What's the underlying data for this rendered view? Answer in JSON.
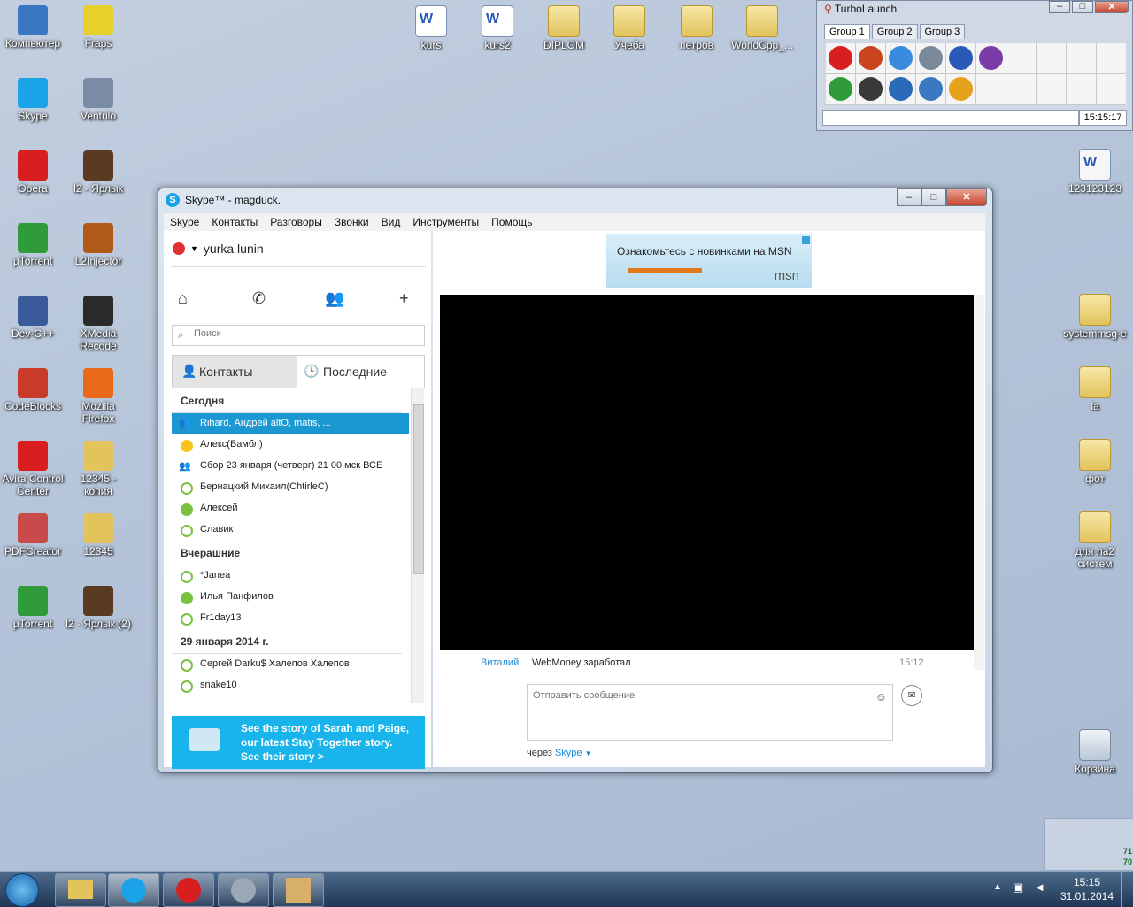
{
  "desktop": {
    "icons_left": [
      {
        "label": "Компьютер",
        "color": "#3a78c2"
      },
      {
        "label": "Fraps",
        "color": "#e6d12a"
      },
      {
        "label": "Skype",
        "color": "#1aa3e6"
      },
      {
        "label": "Ventrilo",
        "color": "#7a8ca5"
      },
      {
        "label": "Opera",
        "color": "#d81e1e"
      },
      {
        "label": "l2 - Ярлык",
        "color": "#5a3a20"
      },
      {
        "label": "µTorrent",
        "color": "#2f9b3a"
      },
      {
        "label": "L2Injector",
        "color": "#b05a18"
      },
      {
        "label": "Dev-C++",
        "color": "#3a5a9a"
      },
      {
        "label": "XMedia Recode",
        "color": "#2a2a2a"
      },
      {
        "label": "CodeBlocks",
        "color": "#c83a2a"
      },
      {
        "label": "Mozilla Firefox",
        "color": "#e86a18"
      },
      {
        "label": "Avira Control Center",
        "color": "#d81e1e"
      },
      {
        "label": "12345 - копия",
        "color": "#e2c35c"
      },
      {
        "label": "PDFCreator",
        "color": "#c84a4a"
      },
      {
        "label": "12345",
        "color": "#e2c35c"
      },
      {
        "label": "µTorrent",
        "color": "#2f9b3a"
      },
      {
        "label": "l2 - Ярлык (2)",
        "color": "#5a3a20"
      }
    ],
    "icons_top": [
      {
        "label": "kurs",
        "type": "doc"
      },
      {
        "label": "kurs2",
        "type": "doc"
      },
      {
        "label": "DIPLOM",
        "type": "folder"
      },
      {
        "label": "Учеба",
        "type": "folder"
      },
      {
        "label": "петров",
        "type": "folder"
      },
      {
        "label": "WorldCpp_...",
        "type": "folder"
      }
    ],
    "icons_right": [
      {
        "label": "123123123",
        "type": "file"
      },
      {
        "label": "systemmsg-e",
        "type": "folder"
      },
      {
        "label": "la",
        "type": "folder"
      },
      {
        "label": "фот",
        "type": "folder"
      },
      {
        "label": "для ла2 систем",
        "type": "folder"
      },
      {
        "label": "Корзина",
        "type": "bin"
      }
    ]
  },
  "turbolaunch": {
    "title": "TurboLaunch",
    "tabs": [
      "Group 1",
      "Group 2",
      "Group 3"
    ],
    "clock": "15:15:17",
    "icon_colors": [
      "#d81e1e",
      "#c8451e",
      "#3a8ae0",
      "#7a8a9a",
      "#2a5ab8",
      "#7a3aa8",
      "#2f9b3a",
      "#3a3a3a",
      "#2a6ab8",
      "#3a78c2",
      "#e6a21a"
    ]
  },
  "skype": {
    "title": "Skype™ - magduck.",
    "menu": [
      "Skype",
      "Контакты",
      "Разговоры",
      "Звонки",
      "Вид",
      "Инструменты",
      "Помощь"
    ],
    "user": "yurka lunin",
    "search_placeholder": "Поиск",
    "tabs": {
      "contacts": "Контакты",
      "recent": "Последние"
    },
    "sections": [
      {
        "header": "Сегодня",
        "items": [
          {
            "name": "Rihard, Андрей altO, matis, ...",
            "status": "group",
            "selected": true
          },
          {
            "name": "Алекс(Бамбл)",
            "status": "away"
          },
          {
            "name": "Сбор 23 января (четверг) 21 00 мск ВСЕ",
            "status": "group"
          },
          {
            "name": "Бернацкий Михаил(ChtirleC)",
            "status": "offline"
          },
          {
            "name": "Алексей",
            "status": "online"
          },
          {
            "name": "Славик",
            "status": "offline"
          }
        ]
      },
      {
        "header": "Вчерашние",
        "items": [
          {
            "name": "*Janea",
            "status": "offline"
          },
          {
            "name": "Илья Панфилов",
            "status": "online"
          },
          {
            "name": "Fr1day13",
            "status": "offline"
          }
        ]
      },
      {
        "header": "29 января 2014 г.",
        "items": [
          {
            "name": "Сергей Darku$ Халепов Халепов",
            "status": "offline"
          },
          {
            "name": "snake10",
            "status": "offline"
          }
        ]
      }
    ],
    "promo": {
      "line1": "See the story of Sarah and Paige,",
      "line2": "our latest Stay Together story.",
      "line3": "See their story >"
    },
    "ad_text": "Ознакомьтесь с новинками на MSN",
    "ad_brand": "msn",
    "message": {
      "sender": "Виталий",
      "text": "WebMoney заработал",
      "time": "15:12"
    },
    "input_placeholder": "Отправить сообщение",
    "via_label": "через",
    "via_link": "Skype"
  },
  "taskbar": {
    "time": "15:15",
    "date": "31.01.2014"
  },
  "widget": {
    "values": [
      "71",
      "70"
    ]
  }
}
